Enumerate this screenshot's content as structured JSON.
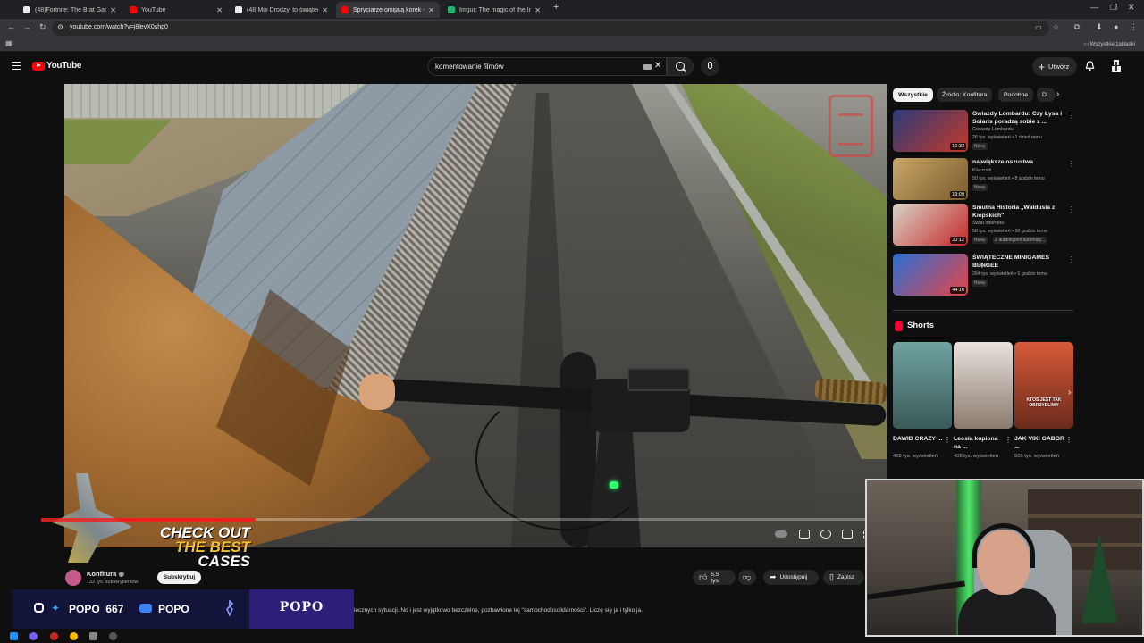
{
  "browser": {
    "tabs": [
      {
        "title": "(48)Fortnite: The Brat Gada Ga...",
        "fav": "#e8eaed",
        "active": false
      },
      {
        "title": "YouTube",
        "fav": "#ff0000",
        "active": false
      },
      {
        "title": "(48)Moi Drodzy, to świąteczny...",
        "fav": "#e8eaed",
        "active": false
      },
      {
        "title": "Spryciarze omijają korek - ...",
        "fav": "#ff0000",
        "active": true
      },
      {
        "title": "Imgur: The magic of the Interne...",
        "fav": "#1bb76e",
        "active": false
      }
    ],
    "url": "youtube.com/watch?v=j8levX0shp0",
    "bookmarks_all": "Wszystkie zakładki"
  },
  "youtube": {
    "logo": "YouTube",
    "search_value": "komentowanie filmów",
    "create_label": "Utwórz"
  },
  "video": {
    "progress": 0.23
  },
  "promo": {
    "line1": "CHECK OUT",
    "line2": "THE BEST",
    "line3": "CASES"
  },
  "channel": {
    "name": "Konfitura",
    "subs": "132 tys. subskrybentów",
    "subscribe": "Subskrybuj",
    "likes": "5,5 tys.",
    "share": "Udostępnij",
    "save": "Zapisz"
  },
  "description": "iecznych sytuacji. No i jest wyjątkowo bezczelne, pozbawione tej \"samochodosolidarności\". Liczę się ja i tylko ja.",
  "social": {
    "handle1": "POPO_667",
    "handle2": "POPO",
    "box": "POPO"
  },
  "chips": [
    "Wszystkie",
    "Źródło: Konfitura",
    "Podobne",
    "Dl"
  ],
  "recommendations": [
    {
      "title": "Gwiazdy Lombardu: Czy Łysa i Solaris poradzą sobie z ...",
      "channel": "Gwiazdy Lombardu",
      "stats": "26 tys. wyświetleń • 1 dzień temu",
      "badge": "Nowy",
      "duration": "16:33",
      "color1": "#2b3a7a",
      "color2": "#c23a2a"
    },
    {
      "title": "największe oszustwa",
      "channel": "Kloczuch",
      "stats": "50 tys. wyświetleń • 8 godzin temu",
      "badge": "Nowy",
      "duration": "19:09",
      "color1": "#caa86a",
      "color2": "#7a5a2a"
    },
    {
      "title": "Smutna Historia „Waldusia z Kiepskich\"",
      "channel": "Świat Internetu",
      "stats": "58 tys. wyświetleń • 10 godzin temu",
      "badge": "Nowy",
      "extra": "Z dubbingiem automaty...",
      "duration": "20:12",
      "color1": "#d8d4c8",
      "color2": "#c62828"
    },
    {
      "title": "ŚWIĄTECZNE MINIGAMES BUNGEE",
      "channel": "Bungee",
      "stats": "264 tys. wyświetleń • 5 godzin temu",
      "badge": "Nowy",
      "duration": "44:10",
      "color1": "#2a6fd6",
      "color2": "#e64545"
    }
  ],
  "shorts": {
    "title": "Shorts",
    "items": [
      {
        "title": "DAWID CRAZY ...",
        "views": "459 tys. wyświetleń",
        "color1": "#6fa3a0",
        "color2": "#3a5a58"
      },
      {
        "title": "Leosia kupiona na ...",
        "views": "408 tys. wyświetleń",
        "color1": "#e8e2dc",
        "color2": "#8a7a6e"
      },
      {
        "title": "JAK VIKI GABOR ...",
        "views": "505 tys. wyświetleń",
        "color1": "#d85a3a",
        "color2": "#6a2a1a",
        "caption": "KTOŚ JEST TAK OBRZYDLIWY"
      }
    ]
  }
}
